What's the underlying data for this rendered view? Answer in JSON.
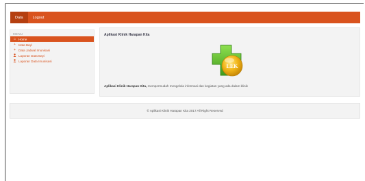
{
  "navbar": {
    "items": [
      {
        "label": "Data"
      },
      {
        "label": "Logout"
      }
    ]
  },
  "sidebar": {
    "header": "MENU",
    "items": [
      {
        "label": "Home",
        "icon": "home-icon"
      },
      {
        "label": "Data Bayi",
        "icon": "plus-icon"
      },
      {
        "label": "Data Jadwal Imunisasi",
        "icon": "plus-icon"
      },
      {
        "label": "Laporan Data Bayi",
        "icon": "user-icon"
      },
      {
        "label": "Laporan Data Imunisasi",
        "icon": "user-icon"
      }
    ]
  },
  "main": {
    "title": "Aplikasi Klinik Harapan Kita",
    "logo_text": "LEK",
    "description_bold": "Aplikasi Klinik Harapan Kita,",
    "description_rest": " mempermudah mengelola informasi dan kegiatan yang ada dalam klinik"
  },
  "footer": {
    "text": "© Aplikasi Klinik Harapan Kita 2017 All Right Reserved"
  },
  "colors": {
    "accent": "#d9531e",
    "accent_dark": "#b53f10",
    "panel": "#f3f3f3",
    "logo_green": "#5cb82e"
  }
}
